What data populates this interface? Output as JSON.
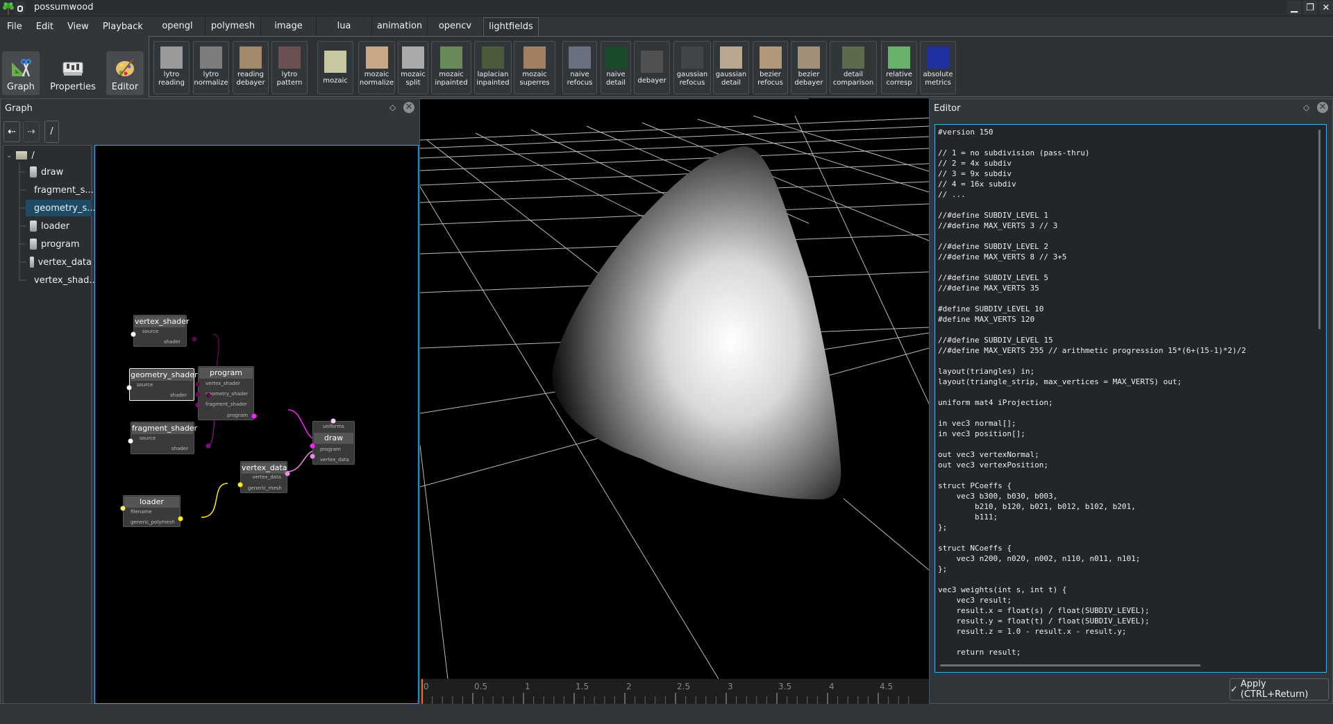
{
  "window": {
    "title": "possumwood",
    "controls": {
      "minimize": "▁",
      "restore": "❐",
      "close": "✕"
    }
  },
  "menu": [
    "File",
    "Edit",
    "View",
    "Playback"
  ],
  "tabs": [
    {
      "label": "opengl",
      "active": false
    },
    {
      "label": "polymesh",
      "active": false
    },
    {
      "label": "image",
      "active": false
    },
    {
      "label": "lua",
      "active": false
    },
    {
      "label": "animation",
      "active": false
    },
    {
      "label": "opencv",
      "active": false
    },
    {
      "label": "lightfields",
      "active": true
    }
  ],
  "modes": [
    {
      "label": "Graph",
      "icon": "graph-tools-icon",
      "active": true
    },
    {
      "label": "Properties",
      "icon": "properties-sliders-icon",
      "active": false
    },
    {
      "label": "Editor",
      "icon": "paint-palette-icon",
      "active": true
    }
  ],
  "toolbar": [
    {
      "label": "lytro\nreading",
      "thumb": "#9a9a9a"
    },
    {
      "label": "lytro\nnormalize",
      "thumb": "#7d7d7d"
    },
    {
      "label": "reading\ndebayer",
      "thumb": "#a08a6a"
    },
    {
      "label": "lytro\npattern",
      "thumb": "#6a5050"
    },
    {
      "label": "mozaic",
      "thumb": "#c8c8a0"
    },
    {
      "label": "mozaic\nnormalize",
      "thumb": "#c8a888"
    },
    {
      "label": "mozaic\nsplit",
      "thumb": "#aaaaaa"
    },
    {
      "label": "mozaic\ninpainted",
      "thumb": "#6a8a5a"
    },
    {
      "label": "laplacian\ninpainted",
      "thumb": "#4a5a3a"
    },
    {
      "label": "mozaic\nsuperres",
      "thumb": "#a08060"
    },
    {
      "label": "naive\nrefocus",
      "thumb": "#6a7080"
    },
    {
      "label": "naive\ndetail",
      "thumb": "#1a4a2a"
    },
    {
      "label": "debayer",
      "thumb": "#505050"
    },
    {
      "label": "gaussian\nrefocus",
      "thumb": "#404548"
    },
    {
      "label": "gaussian\ndetail",
      "thumb": "#b8a890"
    },
    {
      "label": "bezier\nrefocus",
      "thumb": "#b09878"
    },
    {
      "label": "bezier\ndebayer",
      "thumb": "#a09078"
    },
    {
      "label": "detail\ncomparison",
      "thumb": "#5a6a4a"
    },
    {
      "label": "relative\ncorresp",
      "thumb": "#6ab06a"
    },
    {
      "label": "absolute\nmetrics",
      "thumb": "#2030a0"
    }
  ],
  "graph_dock": {
    "title": "Graph",
    "nav": {
      "back": "⇠",
      "forward": "⇢"
    },
    "path": "/",
    "tree_root": "/",
    "tree_items": [
      {
        "label": "draw",
        "selected": false
      },
      {
        "label": "fragment_s...",
        "selected": false
      },
      {
        "label": "geometry_s...",
        "selected": true
      },
      {
        "label": "loader",
        "selected": false
      },
      {
        "label": "program",
        "selected": false
      },
      {
        "label": "vertex_data",
        "selected": false
      },
      {
        "label": "vertex_shad...",
        "selected": false
      }
    ],
    "nodes": {
      "vertex_shader": {
        "title": "vertex_shader",
        "in": [
          "source"
        ],
        "out": [
          "shader"
        ]
      },
      "geometry_shader": {
        "title": "geometry_shader",
        "in": [
          "source"
        ],
        "out": [
          "shader"
        ],
        "selected": true
      },
      "fragment_shader": {
        "title": "fragment_shader",
        "in": [
          "source"
        ],
        "out": [
          "shader"
        ]
      },
      "program": {
        "title": "program",
        "in": [
          "vertex_shader",
          "geometry_shader",
          "fragment_shader"
        ],
        "out": [
          "program"
        ]
      },
      "draw": {
        "title": "draw",
        "top": [
          "uniforms"
        ],
        "in": [
          "program",
          "vertex_data"
        ]
      },
      "vertex_data": {
        "title": "vertex_data",
        "out": [
          "vertex_data"
        ],
        "in": [
          "generic_mesh"
        ]
      },
      "loader": {
        "title": "loader",
        "in": [
          "filename"
        ],
        "out": [
          "generic_polymesh"
        ]
      }
    },
    "port_colors": {
      "source": "#ffffff",
      "shader": "#5a0a4a",
      "program": "#ff20ff",
      "vertex_data": "#ee88ee",
      "mesh": "#ffee00",
      "uniforms": "#ffccff"
    }
  },
  "timeline": {
    "ticks": [
      "0",
      "0.5",
      "1",
      "1.5",
      "2",
      "2.5",
      "3",
      "3.5",
      "4",
      "4.5"
    ],
    "current": 0,
    "cursor_color": "#f67400"
  },
  "editor_dock": {
    "title": "Editor",
    "code": "#version 150\n\n// 1 = no subdivision (pass-thru)\n// 2 = 4x subdiv\n// 3 = 9x subdiv\n// 4 = 16x subdiv\n// ...\n\n//#define SUBDIV_LEVEL 1\n//#define MAX_VERTS 3 // 3\n\n//#define SUBDIV_LEVEL 2\n//#define MAX_VERTS 8 // 3+5\n\n//#define SUBDIV_LEVEL 5\n//#define MAX_VERTS 35\n\n#define SUBDIV_LEVEL 10\n#define MAX_VERTS 120\n\n//#define SUBDIV_LEVEL 15\n//#define MAX_VERTS 255 // arithmetic progression 15*(6+(15-1)*2)/2\n\nlayout(triangles) in;\nlayout(triangle_strip, max_vertices = MAX_VERTS) out;\n\nuniform mat4 iProjection;\n\nin vec3 normal[];\nin vec3 position[];\n\nout vec3 vertexNormal;\nout vec3 vertexPosition;\n\nstruct PCoeffs {\n    vec3 b300, b030, b003,\n        b210, b120, b021, b012, b102, b201,\n        b111;\n};\n\nstruct NCoeffs {\n    vec3 n200, n020, n002, n110, n011, n101;\n};\n\nvec3 weights(int s, int t) {\n    vec3 result;\n    result.x = float(s) / float(SUBDIV_LEVEL);\n    result.y = float(t) / float(SUBDIV_LEVEL);\n    result.z = 1.0 - result.x - result.y;\n\n    return result;",
    "apply_label": "Apply (CTRL+Return)",
    "apply_icon": "✓"
  },
  "dock_icons": {
    "float": "◇",
    "close": "✕"
  }
}
